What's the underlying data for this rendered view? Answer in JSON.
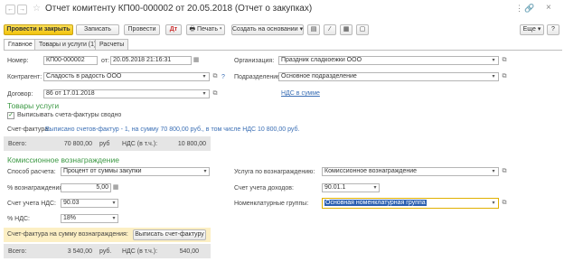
{
  "header": {
    "title": "Отчет комитенту КП00-000002 от 20.05.2018 (Отчет о закупках)",
    "star": "☆"
  },
  "toolbar": {
    "post_close": "Провести и закрыть",
    "save": "Записать",
    "post": "Провести",
    "print": "Печать",
    "create_based": "Создать на основании",
    "more": "Еще",
    "help": "?"
  },
  "tabs": [
    "Главное",
    "Товары и услуги (1)",
    "Расчеты"
  ],
  "main": {
    "number_label": "Номер:",
    "number_value": "КП00-000002",
    "date_label": "от:",
    "date_value": "20.05.2018 21:16:31",
    "org_label": "Организация:",
    "org_value": "Праздник сладкоежки ООО",
    "contractor_label": "Контрагент:",
    "contractor_value": "Сладость в радость ООО",
    "contractor_help": "?",
    "division_label": "Подразделение:",
    "division_value": "Основное подразделение",
    "contract_label": "Договор:",
    "contract_value": "86 от 17.01.2018",
    "vat_link": "НДС в сумме"
  },
  "goods": {
    "section_title": "Товары услуги",
    "invoice_checkbox": "Выписывать счета-фактуры сводно",
    "invoice_label": "Счет-фактура:",
    "invoice_link": "Выписано счетов-фактур - 1, на сумму 70 800,00 руб., в том числе НДС 10 800,00 руб.",
    "total_label": "Всего:",
    "total_value": "70 800,00",
    "currency": "руб",
    "vat_label": "НДС (в т.ч.):",
    "vat_value": "10 800,00"
  },
  "commission": {
    "section_title": "Комиссионное вознаграждение",
    "calc_method_label": "Способ расчета:",
    "calc_method_value": "Процент от суммы закупки",
    "service_label": "Услуга по вознаграждению:",
    "service_value": "Комиссионное вознаграждение",
    "percent_label": "% вознаграждения:",
    "percent_value": "5,00",
    "income_account_label": "Счет учета доходов:",
    "income_account_value": "90.01.1",
    "vat_account_label": "Счет учета НДС:",
    "vat_account_value": "90.03",
    "nomenclature_label": "Номенклатурные группы:",
    "nomenclature_value": "Основная номенклатурная группа",
    "vat_rate_label": "% НДС:",
    "vat_rate_value": "18%",
    "invoice_reward_label": "Счет-фактура на сумму вознаграждения:",
    "invoice_reward_button": "Выписать счет-фактуру",
    "total_label": "Всего:",
    "total_value": "3 540,00",
    "currency": "руб.",
    "vat_label": "НДС (в т.ч.):",
    "vat_value": "540,00"
  }
}
